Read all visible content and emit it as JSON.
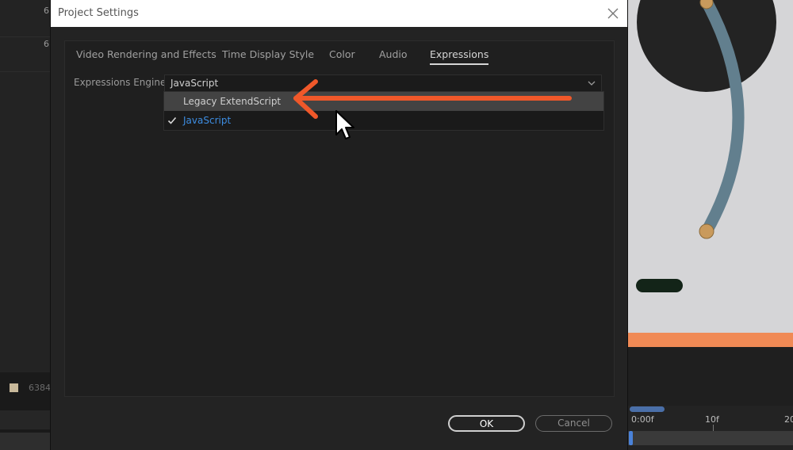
{
  "background": {
    "layer_numbers": [
      "6",
      "6"
    ],
    "layer_id": "6384",
    "timeline": {
      "labels": [
        "0:00f",
        "10f",
        "20"
      ]
    },
    "colors": {
      "accent_orange": "#f08a55",
      "selection_blue": "#3d8de2",
      "preview_stroke": "#627f8e"
    }
  },
  "dialog": {
    "title": "Project Settings",
    "close_icon": "close-icon",
    "tabs": [
      {
        "label": "Video Rendering and Effects",
        "active": false
      },
      {
        "label": "Time Display Style",
        "active": false
      },
      {
        "label": "Color",
        "active": false
      },
      {
        "label": "Audio",
        "active": false
      },
      {
        "label": "Expressions",
        "active": true
      }
    ],
    "expressions": {
      "engine_label": "Expressions Engine:",
      "selected": "JavaScript",
      "options": [
        {
          "label": "Legacy ExtendScript",
          "hovered": true,
          "checked": false
        },
        {
          "label": "JavaScript",
          "hovered": false,
          "checked": true
        }
      ]
    },
    "buttons": {
      "ok": "OK",
      "cancel": "Cancel"
    }
  }
}
